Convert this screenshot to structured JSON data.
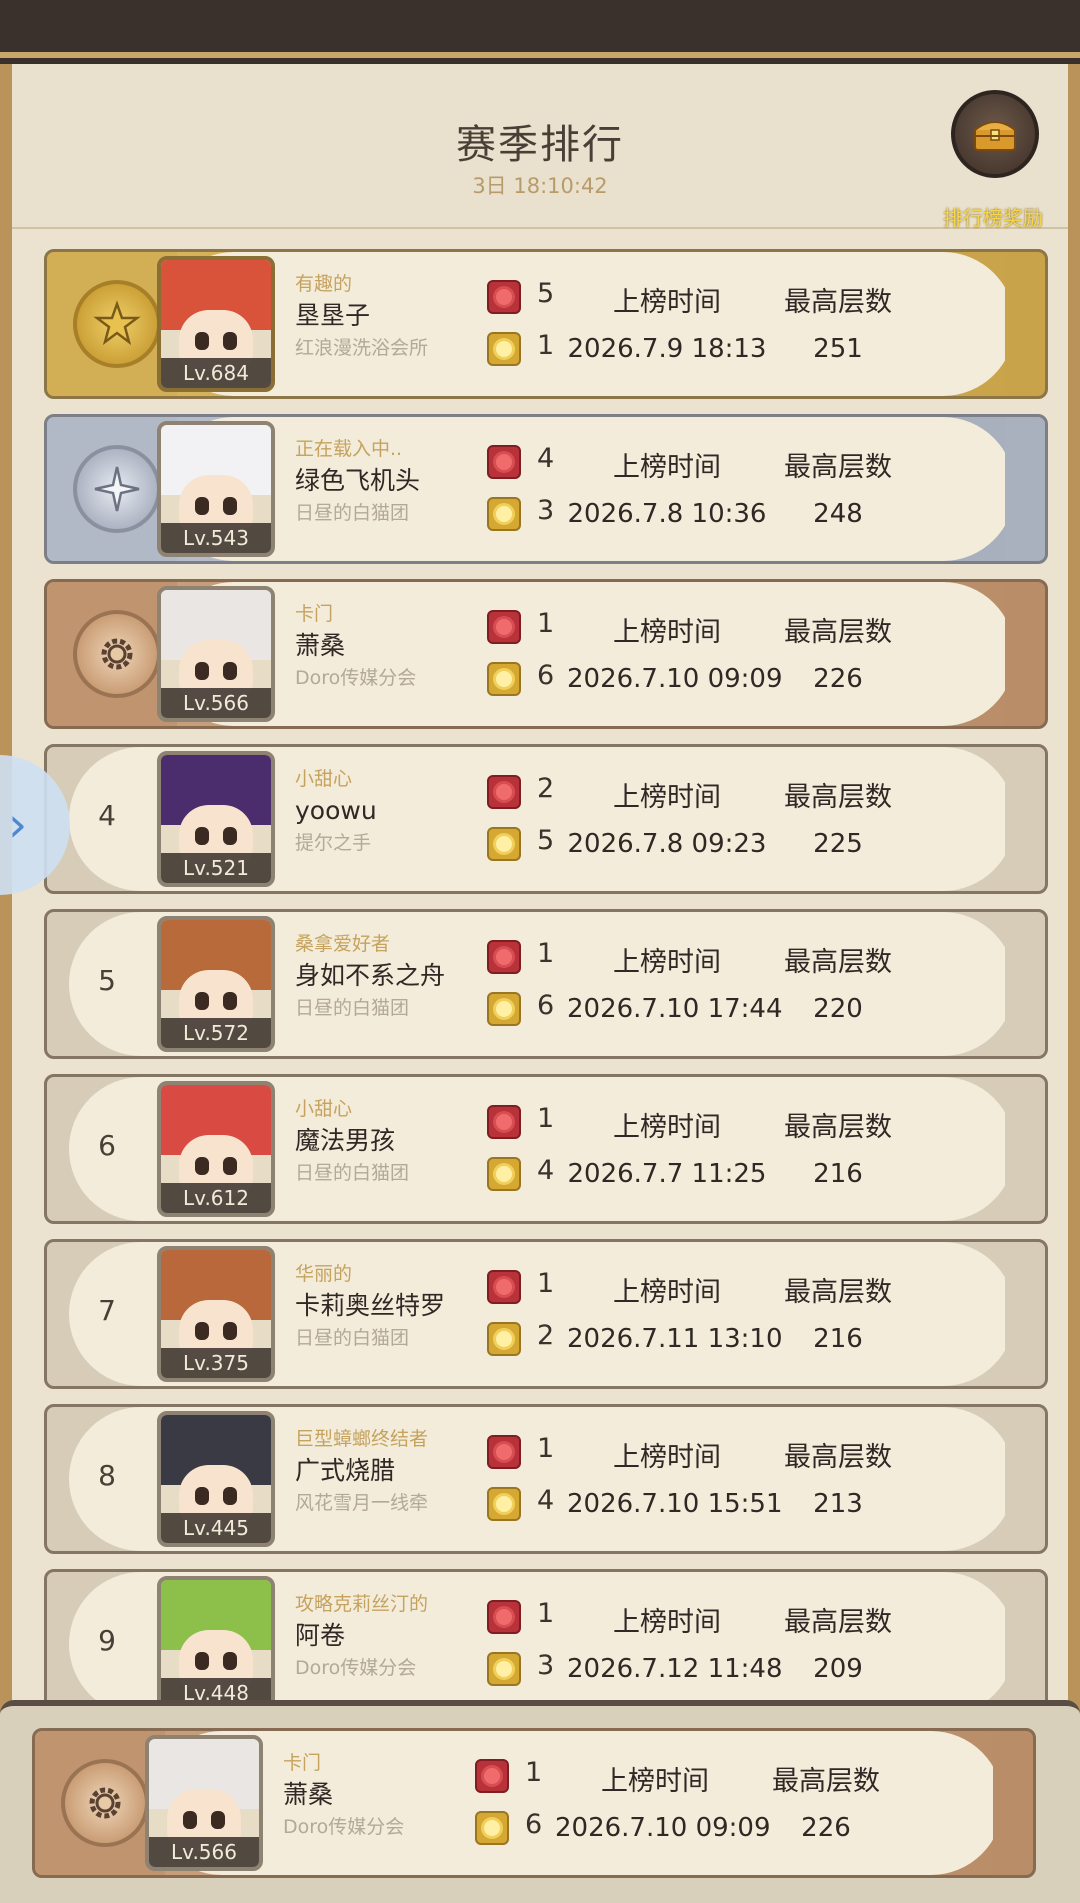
{
  "header": {
    "title": "赛季排行",
    "timer": "3日 18:10:42",
    "reward_label": "排行榜奖励"
  },
  "columns": {
    "time_label": "上榜时间",
    "floor_label": "最高层数"
  },
  "rows": [
    {
      "rank": "1",
      "medal": "gold",
      "level": "Lv.684",
      "title": "有趣的",
      "name": "垦垦子",
      "guild": "红浪漫洗浴会所",
      "red": "5",
      "gold": "1",
      "time": "2026.7.9 18:13",
      "floor": "251",
      "hair": "#d9523a"
    },
    {
      "rank": "2",
      "medal": "silver",
      "level": "Lv.543",
      "title": "正在载入中..",
      "name": "绿色飞机头",
      "guild": "日昼的白猫团",
      "red": "4",
      "gold": "3",
      "time": "2026.7.8 10:36",
      "floor": "248",
      "hair": "#f2f2f4"
    },
    {
      "rank": "3",
      "medal": "bronze",
      "level": "Lv.566",
      "title": "卡门",
      "name": "萧桑",
      "guild": "Doro传媒分会",
      "red": "1",
      "gold": "6",
      "time": "2026.7.10 09:09",
      "floor": "226",
      "hair": "#e9e6e4"
    },
    {
      "rank": "4",
      "medal": "plain",
      "level": "Lv.521",
      "title": "小甜心",
      "name": "yoowu",
      "guild": "提尔之手",
      "red": "2",
      "gold": "5",
      "time": "2026.7.8 09:23",
      "floor": "225",
      "hair": "#4b2d6e"
    },
    {
      "rank": "5",
      "medal": "plain",
      "level": "Lv.572",
      "title": "桑拿爱好者",
      "name": "身如不系之舟",
      "guild": "日昼的白猫团",
      "red": "1",
      "gold": "6",
      "time": "2026.7.10 17:44",
      "floor": "220",
      "hair": "#b86a3a"
    },
    {
      "rank": "6",
      "medal": "plain",
      "level": "Lv.612",
      "title": "小甜心",
      "name": "魔法男孩",
      "guild": "日昼的白猫团",
      "red": "1",
      "gold": "4",
      "time": "2026.7.7 11:25",
      "floor": "216",
      "hair": "#d94a42"
    },
    {
      "rank": "7",
      "medal": "plain",
      "level": "Lv.375",
      "title": "华丽的",
      "name": "卡莉奥丝特罗",
      "guild": "日昼的白猫团",
      "red": "1",
      "gold": "2",
      "time": "2026.7.11 13:10",
      "floor": "216",
      "hair": "#b8683a"
    },
    {
      "rank": "8",
      "medal": "plain",
      "level": "Lv.445",
      "title": "巨型蟑螂终结者",
      "name": "广式烧腊",
      "guild": "风花雪月一线牵",
      "red": "1",
      "gold": "4",
      "time": "2026.7.10 15:51",
      "floor": "213",
      "hair": "#3a3a44"
    },
    {
      "rank": "9",
      "medal": "plain",
      "level": "Lv.448",
      "title": "攻略克莉丝汀的",
      "name": "阿卷",
      "guild": "Doro传媒分会",
      "red": "1",
      "gold": "3",
      "time": "2026.7.12 11:48",
      "floor": "209",
      "hair": "#8cc04a"
    }
  ],
  "self_row": {
    "rank": "3",
    "medal": "bronze",
    "level": "Lv.566",
    "title": "卡门",
    "name": "萧桑",
    "guild": "Doro传媒分会",
    "red": "1",
    "gold": "6",
    "time": "2026.7.10 09:09",
    "floor": "226",
    "hair": "#e9e6e4"
  },
  "icons": {
    "red_badge": "red-rose-badge-icon",
    "gold_badge": "gold-flower-badge-icon",
    "reward": "treasure-chest-icon",
    "side_tab": "chevron-right-icon"
  }
}
